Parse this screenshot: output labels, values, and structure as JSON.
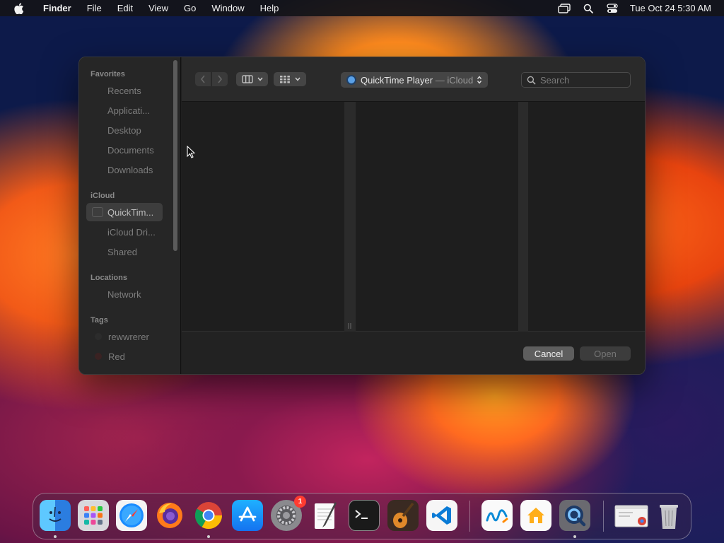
{
  "menubar": {
    "app_name": "Finder",
    "items": [
      "File",
      "Edit",
      "View",
      "Go",
      "Window",
      "Help"
    ],
    "clock": "Tue Oct 24  5:30 AM",
    "status_icons": [
      "screen-mirroring-icon",
      "spotlight-search-icon",
      "control-center-icon"
    ]
  },
  "dialog": {
    "location": {
      "name": "QuickTime Player",
      "separator": " — ",
      "scope": "iCloud"
    },
    "search": {
      "placeholder": "Search",
      "value": ""
    },
    "buttons": {
      "cancel": "Cancel",
      "open": "Open"
    },
    "sidebar": {
      "favorites_title": "Favorites",
      "favorites": [
        "Recents",
        "Applicati...",
        "Desktop",
        "Documents",
        "Downloads"
      ],
      "icloud_title": "iCloud",
      "icloud": [
        "QuickTim...",
        "iCloud Dri...",
        "Shared"
      ],
      "selected": "QuickTim...",
      "locations_title": "Locations",
      "locations": [
        "Network"
      ],
      "tags_title": "Tags",
      "tags": [
        {
          "label": "rewwrerer",
          "color": "#3a3a3a"
        },
        {
          "label": "Red",
          "color": "#4a2222"
        }
      ]
    },
    "view_mode": "column"
  },
  "dock": {
    "apps": [
      {
        "name": "Finder",
        "icon": "finder-icon",
        "running": true
      },
      {
        "name": "Launchpad",
        "icon": "launchpad-icon",
        "running": false
      },
      {
        "name": "Safari",
        "icon": "safari-icon",
        "running": false
      },
      {
        "name": "Firefox",
        "icon": "firefox-icon",
        "running": false
      },
      {
        "name": "Google Chrome",
        "icon": "chrome-icon",
        "running": true
      },
      {
        "name": "App Store",
        "icon": "app-store-icon",
        "running": false
      },
      {
        "name": "System Settings",
        "icon": "system-settings-icon",
        "running": false,
        "badge": "1"
      },
      {
        "name": "TextEdit",
        "icon": "textedit-icon",
        "running": false
      },
      {
        "name": "Terminal",
        "icon": "terminal-icon",
        "running": false
      },
      {
        "name": "GarageBand",
        "icon": "garageband-icon",
        "running": false
      },
      {
        "name": "Visual Studio Code",
        "icon": "vscode-icon",
        "running": false
      },
      {
        "name": "Freeform",
        "icon": "freeform-icon",
        "running": false
      },
      {
        "name": "Home",
        "icon": "home-icon",
        "running": false
      },
      {
        "name": "QuickTime Player",
        "icon": "quicktime-icon",
        "running": true
      },
      {
        "name": "Chrome window",
        "icon": "chrome-window-icon",
        "running": false
      },
      {
        "name": "Trash",
        "icon": "trash-icon",
        "running": false
      }
    ]
  }
}
